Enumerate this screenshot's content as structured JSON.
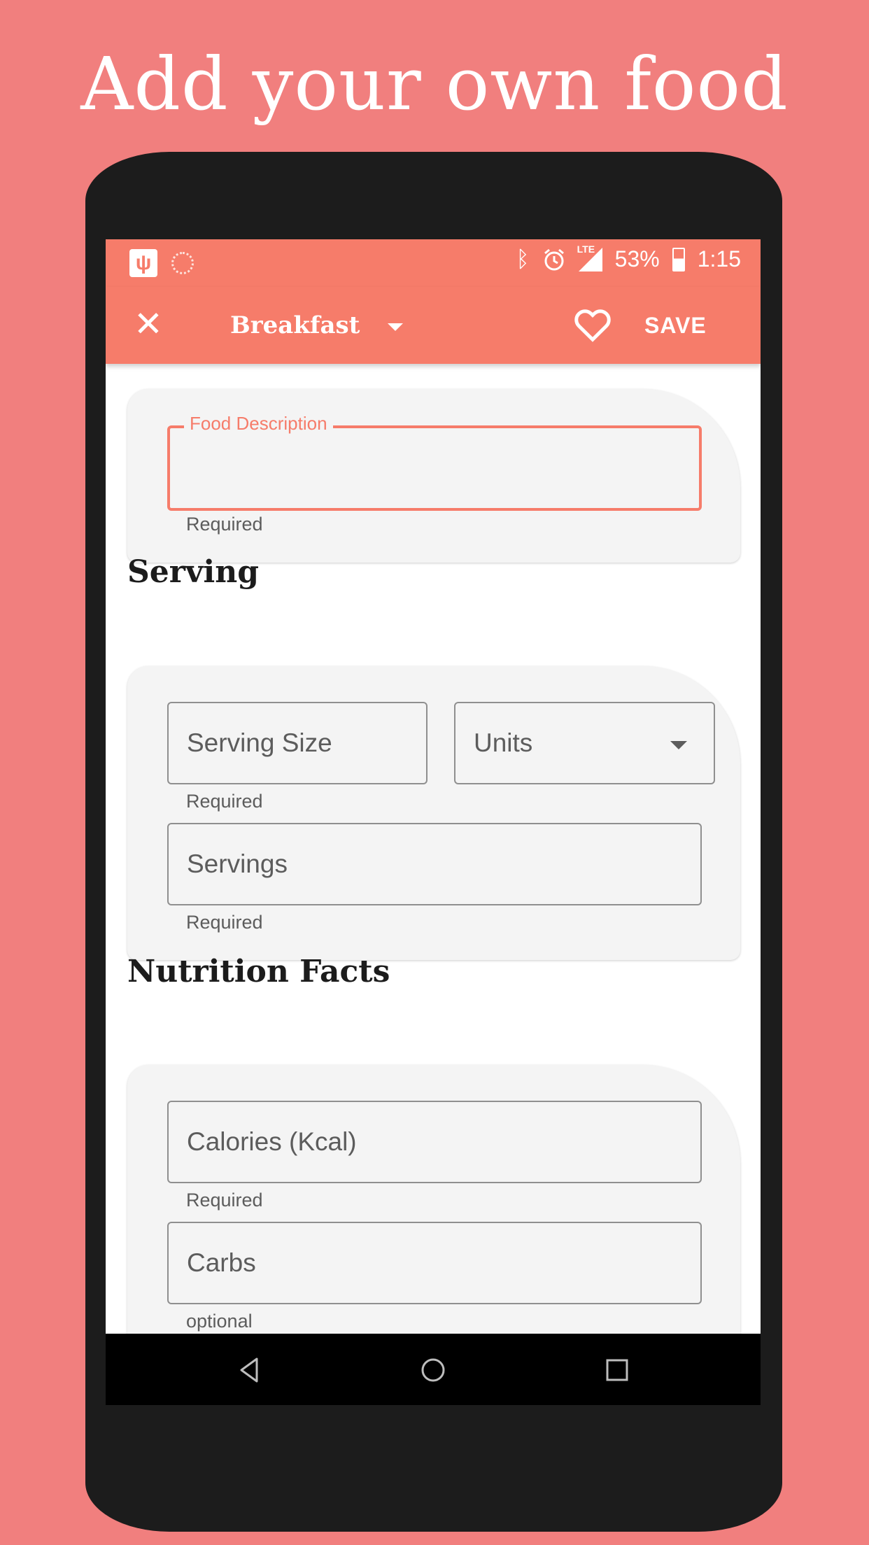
{
  "headline": "Add your own food",
  "status_bar": {
    "battery": "53%",
    "time": "1:15",
    "network": "LTE",
    "icons": [
      "usb-icon",
      "notification-icon",
      "bluetooth-icon",
      "alarm-icon",
      "signal-icon",
      "battery-icon"
    ]
  },
  "toolbar": {
    "close_icon": "close-icon",
    "meal": "Breakfast",
    "favorite_icon": "heart-icon",
    "save_label": "SAVE"
  },
  "description_card": {
    "label": "Food Description",
    "value": "",
    "helper": "Required"
  },
  "serving_section": {
    "title": "Serving",
    "serving_size": {
      "placeholder": "Serving Size",
      "helper": "Required"
    },
    "units": {
      "placeholder": "Units"
    },
    "servings": {
      "placeholder": "Servings",
      "helper": "Required"
    }
  },
  "nutrition_section": {
    "title": "Nutrition Facts",
    "calories": {
      "placeholder": "Calories (Kcal)",
      "helper": "Required"
    },
    "carbs": {
      "placeholder": "Carbs",
      "helper": "optional"
    }
  },
  "nav_bar": {
    "icons": [
      "back-icon",
      "home-icon",
      "recents-icon"
    ]
  },
  "colors": {
    "page_background": "#F17F7E",
    "accent": "#F67C6A",
    "phone_body": "#1C1C1C"
  }
}
